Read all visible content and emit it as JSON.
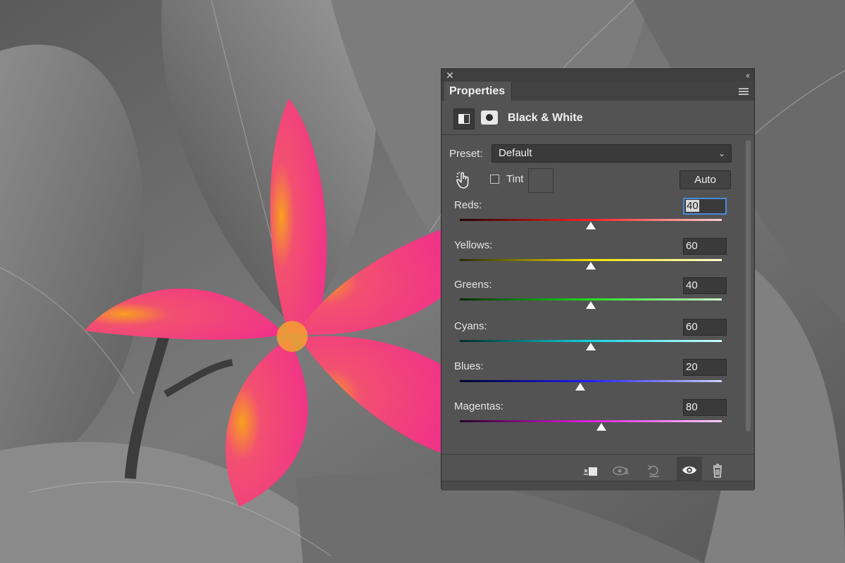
{
  "panel": {
    "tab_label": "Properties",
    "adjustment_title": "Black & White",
    "preset": {
      "label": "Preset:",
      "value": "Default"
    },
    "tint": {
      "label": "Tint",
      "checked": false
    },
    "auto_label": "Auto",
    "sliders": [
      {
        "label": "Reds:",
        "value": "40",
        "position": 0.5,
        "gradient": [
          "#2a0000",
          "#ff2020",
          "#ffd0d0"
        ]
      },
      {
        "label": "Yellows:",
        "value": "60",
        "position": 0.5,
        "gradient": [
          "#2a2a00",
          "#f0e000",
          "#ffffd0"
        ]
      },
      {
        "label": "Greens:",
        "value": "40",
        "position": 0.5,
        "gradient": [
          "#002a00",
          "#20e020",
          "#d0ffd0"
        ]
      },
      {
        "label": "Cyans:",
        "value": "60",
        "position": 0.5,
        "gradient": [
          "#002a2a",
          "#10d8e0",
          "#d0ffff"
        ]
      },
      {
        "label": "Blues:",
        "value": "20",
        "position": 0.46,
        "gradient": [
          "#00002a",
          "#2020ff",
          "#d0d0ff"
        ]
      },
      {
        "label": "Magentas:",
        "value": "80",
        "position": 0.54,
        "gradient": [
          "#2a002a",
          "#e020e0",
          "#ffd0ff"
        ]
      }
    ],
    "footer_icons": [
      "clip-to-layer-icon",
      "view-previous-state-icon",
      "reset-icon",
      "visibility-eye-icon",
      "trash-icon"
    ]
  },
  "colors": {
    "panel_bg": "#535353",
    "field_bg": "#3a3a3a",
    "focus": "#4a8ad8",
    "flower_pink": "#f0307a",
    "flower_center": "#f8a020"
  }
}
